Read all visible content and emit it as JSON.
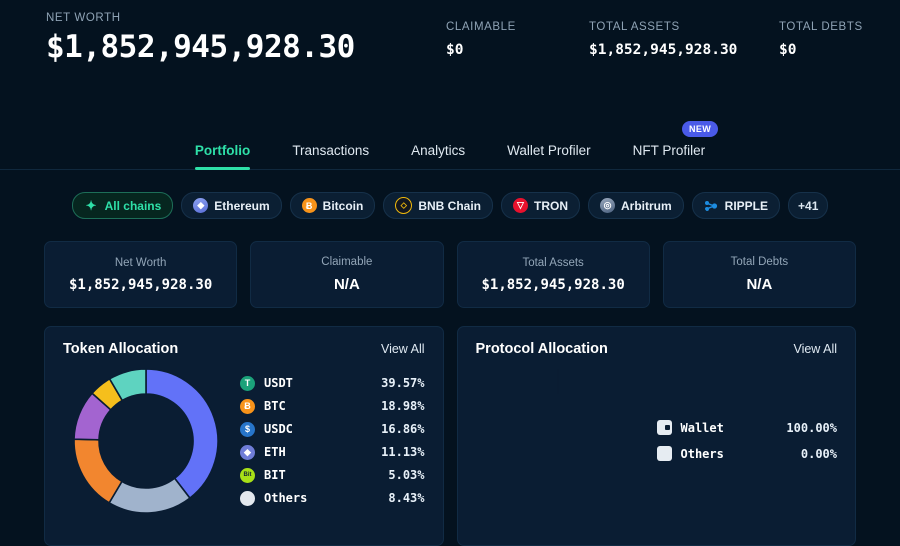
{
  "header": {
    "net_worth_label": "NET WORTH",
    "net_worth_value": "$1,852,945,928.30",
    "stats": [
      {
        "label": "CLAIMABLE",
        "value": "$0"
      },
      {
        "label": "TOTAL ASSETS",
        "value": "$1,852,945,928.30"
      },
      {
        "label": "TOTAL DEBTS",
        "value": "$0"
      }
    ]
  },
  "tabs": [
    {
      "label": "Portfolio",
      "active": true,
      "badge": ""
    },
    {
      "label": "Transactions",
      "active": false,
      "badge": ""
    },
    {
      "label": "Analytics",
      "active": false,
      "badge": ""
    },
    {
      "label": "Wallet Profiler",
      "active": false,
      "badge": ""
    },
    {
      "label": "NFT Profiler",
      "active": false,
      "badge": "NEW"
    }
  ],
  "chains": [
    {
      "label": "All chains",
      "icon": "all-chains-icon",
      "glyph": "✦",
      "active": true
    },
    {
      "label": "Ethereum",
      "icon": "ethereum-icon",
      "glyph": "◆",
      "active": false
    },
    {
      "label": "Bitcoin",
      "icon": "bitcoin-icon",
      "glyph": "Ƀ",
      "active": false
    },
    {
      "label": "BNB Chain",
      "icon": "bnb-chain-icon",
      "glyph": "⬦",
      "active": false
    },
    {
      "label": "TRON",
      "icon": "tron-icon",
      "glyph": "▽",
      "active": false
    },
    {
      "label": "Arbitrum",
      "icon": "arbitrum-icon",
      "glyph": "◎",
      "active": false
    },
    {
      "label": "RIPPLE",
      "icon": "ripple-icon",
      "glyph": "⬢",
      "active": false
    },
    {
      "label": "+41",
      "icon": "more-chains-icon",
      "glyph": "",
      "active": false
    }
  ],
  "stat_cards": [
    {
      "label": "Net Worth",
      "value": "$1,852,945,928.30",
      "is_na": false
    },
    {
      "label": "Claimable",
      "value": "N/A",
      "is_na": true
    },
    {
      "label": "Total Assets",
      "value": "$1,852,945,928.30",
      "is_na": false
    },
    {
      "label": "Total Debts",
      "value": "N/A",
      "is_na": true
    }
  ],
  "token_allocation": {
    "title": "Token Allocation",
    "view_all": "View All"
  },
  "protocol_allocation": {
    "title": "Protocol Allocation",
    "view_all": "View All"
  },
  "chart_data": [
    {
      "type": "pie",
      "title": "Token Allocation",
      "subtitle": "",
      "donut": true,
      "legend_position": "right",
      "categories": [
        "USDT",
        "BTC",
        "USDC",
        "ETH",
        "BIT",
        "Others"
      ],
      "values": [
        39.57,
        18.98,
        16.86,
        11.13,
        5.03,
        8.43
      ],
      "labels": [
        "39.57%",
        "18.98%",
        "16.86%",
        "11.13%",
        "5.03%",
        "8.43%"
      ],
      "colors": [
        "#6272f8",
        "#a0b3cc",
        "#f2862f",
        "#a364d0",
        "#f5bf1c",
        "#5ed3c0"
      ],
      "icon_colors": [
        "#1ba27a",
        "#f7931a",
        "#2775ca",
        "#6f7dd8",
        "#a8e017",
        "#e3e8ee"
      ],
      "xlabel": "",
      "ylabel": ""
    },
    {
      "type": "pie",
      "title": "Protocol Allocation",
      "subtitle": "",
      "donut": true,
      "legend_position": "right",
      "categories": [
        "Wallet",
        "Others"
      ],
      "values": [
        100.0,
        0.0
      ],
      "labels": [
        "100.00%",
        "0.00%"
      ],
      "colors": [
        "#6272f8",
        "#e6ecf2"
      ],
      "xlabel": "",
      "ylabel": ""
    }
  ],
  "theme": {
    "background": "#04121f",
    "card": "#0a1d33",
    "border": "#112b44",
    "accent_green": "#2ee0a8",
    "accent_blue": "#6272f8",
    "muted_text": "#93a6b8"
  }
}
